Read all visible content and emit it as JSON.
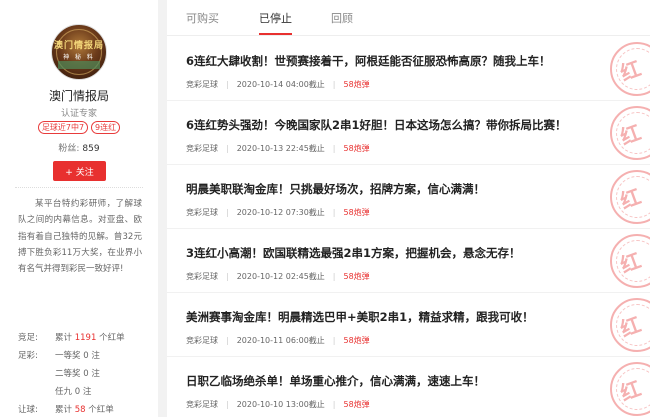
{
  "profile": {
    "avatar_line1": "澳门情报局",
    "avatar_line2": "神 秘 料",
    "name": "澳门情报局",
    "role": "认证专家",
    "tags": [
      "足球近7中7",
      "9连红"
    ],
    "fans_label": "粉丝:",
    "fans_count": "859",
    "follow_label": "+ 关注",
    "bio": "某平台特约彩研师，了解球队之间的内幕信息。对亚盘、欧指有着自己独特的见解。曾32元搏下胜负彩11万大奖，在业界小有名气并得到彩民一致好评!",
    "stats": [
      {
        "key": "竞足:",
        "prefix": "累计",
        "num": "1191",
        "suffix": "个红单"
      },
      {
        "key": "足彩:",
        "prefix": "一等奖",
        "num": "0",
        "suffix": "注"
      },
      {
        "key": "",
        "prefix": "二等奖",
        "num": "0",
        "suffix": "注"
      },
      {
        "key": "",
        "prefix": "任九",
        "num": "0",
        "suffix": "注"
      },
      {
        "key": "让球:",
        "prefix": "累计",
        "num": "58",
        "suffix": "个红单"
      }
    ]
  },
  "tabs": [
    {
      "label": "可购买",
      "active": false
    },
    {
      "label": "已停止",
      "active": true
    },
    {
      "label": "回顾",
      "active": false
    }
  ],
  "stamp_text": "红",
  "items": [
    {
      "title": "6连红大肆收割！世预赛接着干，阿根廷能否征服恐怖高原？随我上车！",
      "category": "竞彩足球",
      "time": "2020-10-14 04:00截止",
      "price": "58炮弹"
    },
    {
      "title": "6连红势头强劲！今晚国家队2串1好胆！日本这场怎么搞？带你拆局比赛！",
      "category": "竞彩足球",
      "time": "2020-10-13 22:45截止",
      "price": "58炮弹"
    },
    {
      "title": "明晨美职联淘金库！只挑最好场次，招牌方案，信心满满！",
      "category": "竞彩足球",
      "time": "2020-10-12 07:30截止",
      "price": "58炮弹"
    },
    {
      "title": "3连红小高潮！欧国联精选最强2串1方案，把握机会，悬念无存！",
      "category": "竞彩足球",
      "time": "2020-10-12 02:45截止",
      "price": "58炮弹"
    },
    {
      "title": "美洲赛事淘金库！明晨精选巴甲+美职2串1，精益求精，跟我可收！",
      "category": "竞彩足球",
      "time": "2020-10-11 06:00截止",
      "price": "58炮弹"
    },
    {
      "title": "日职乙临场绝杀单！单场重心推介，信心满满，速速上车！",
      "category": "竞彩足球",
      "time": "2020-10-10 13:00截止",
      "price": "58炮弹"
    }
  ]
}
